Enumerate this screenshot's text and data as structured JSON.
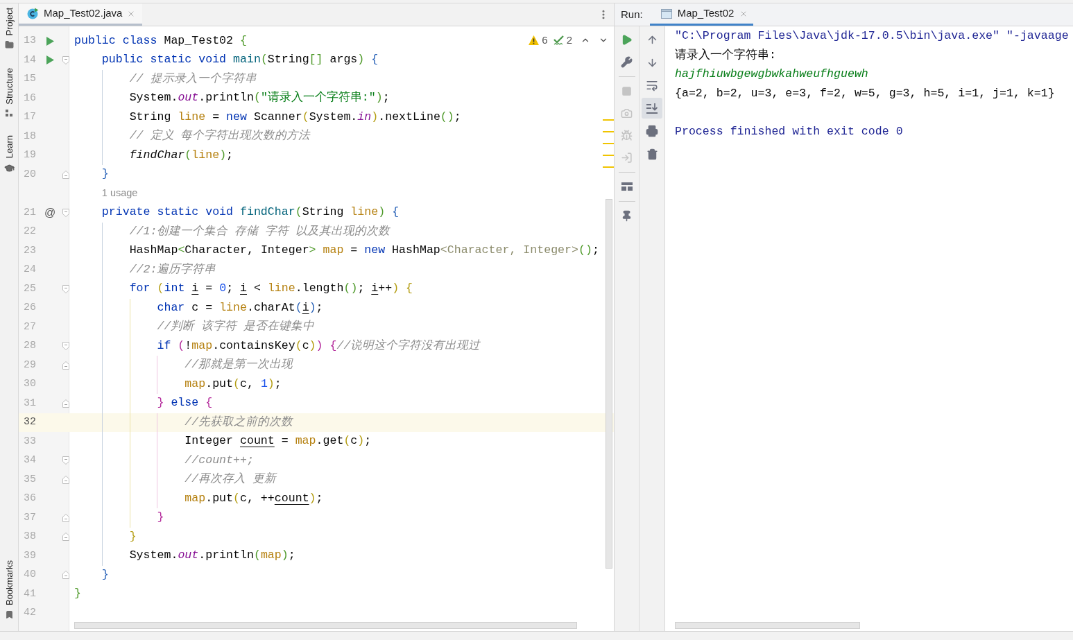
{
  "sidebar": {
    "items": [
      {
        "label": "Project"
      },
      {
        "label": "Structure"
      },
      {
        "label": "Learn"
      },
      {
        "label": "Bookmarks"
      }
    ]
  },
  "editor": {
    "tabs": [
      {
        "label": "Map_Test02.java",
        "selected": true
      }
    ],
    "inspections": {
      "warnings": "6",
      "typos": "2"
    },
    "lines": [
      {
        "number": "13",
        "current": false,
        "gutter_marker": {
          "kind": "run"
        },
        "tokens": [
          {
            "text": "public class ",
            "kind": "keyword"
          },
          {
            "text": "Map_Test02 ",
            "kind": "plain"
          },
          {
            "text": "{",
            "kind": "bracket1"
          }
        ]
      },
      {
        "number": "14",
        "current": false,
        "gutter_marker": {
          "kind": "run"
        },
        "fold_marker": {
          "kind": "start"
        },
        "tokens": [
          {
            "text": "    public static void ",
            "kind": "keyword"
          },
          {
            "text": "main",
            "kind": "declaration"
          },
          {
            "text": "(",
            "kind": "bracket1"
          },
          {
            "text": "String",
            "kind": "plain"
          },
          {
            "text": "[]",
            "kind": "bracket1"
          },
          {
            "text": " args",
            "kind": "plain"
          },
          {
            "text": ") ",
            "kind": "bracket1"
          },
          {
            "text": "{",
            "kind": "bracket2"
          }
        ]
      },
      {
        "number": "15",
        "current": false,
        "tokens": [
          {
            "text": "        // 提示录入一个字符串",
            "kind": "comment"
          }
        ]
      },
      {
        "number": "16",
        "current": false,
        "tokens": [
          {
            "text": "        System.",
            "kind": "plain"
          },
          {
            "text": "out",
            "kind": "field"
          },
          {
            "text": ".println",
            "kind": "plain"
          },
          {
            "text": "(",
            "kind": "bracket1"
          },
          {
            "text": "\"请录入一个字符串:\"",
            "kind": "string"
          },
          {
            "text": ")",
            "kind": "bracket1"
          },
          {
            "text": ";",
            "kind": "plain"
          }
        ]
      },
      {
        "number": "17",
        "current": false,
        "tokens": [
          {
            "text": "        String ",
            "kind": "plain"
          },
          {
            "text": "line",
            "kind": "param"
          },
          {
            "text": " = ",
            "kind": "plain"
          },
          {
            "text": "new ",
            "kind": "keyword"
          },
          {
            "text": "Scanner",
            "kind": "plain"
          },
          {
            "text": "(",
            "kind": "bracket3"
          },
          {
            "text": "System.",
            "kind": "plain"
          },
          {
            "text": "in",
            "kind": "field"
          },
          {
            "text": ")",
            "kind": "bracket3"
          },
          {
            "text": ".nextLine",
            "kind": "plain"
          },
          {
            "text": "()",
            "kind": "bracket1"
          },
          {
            "text": ";",
            "kind": "plain"
          }
        ]
      },
      {
        "number": "18",
        "current": false,
        "tokens": [
          {
            "text": "        // 定义 每个字符出现次数的方法",
            "kind": "comment"
          }
        ]
      },
      {
        "number": "19",
        "current": false,
        "tokens": [
          {
            "text": "        findChar",
            "kind": "static"
          },
          {
            "text": "(",
            "kind": "bracket1"
          },
          {
            "text": "line",
            "kind": "param"
          },
          {
            "text": ")",
            "kind": "bracket1"
          },
          {
            "text": ";",
            "kind": "plain"
          }
        ]
      },
      {
        "number": "20",
        "current": false,
        "fold_marker": {
          "kind": "end"
        },
        "tokens": [
          {
            "text": "    }",
            "kind": "bracket2"
          }
        ]
      },
      {
        "number": "21",
        "current": false,
        "gutter_marker": {
          "kind": "symbol",
          "text": "@"
        },
        "fold_marker": {
          "kind": "start"
        },
        "hint": "1 usage",
        "tokens": [
          {
            "text": "    private static void ",
            "kind": "keyword"
          },
          {
            "text": "findChar",
            "kind": "declaration"
          },
          {
            "text": "(",
            "kind": "bracket1"
          },
          {
            "text": "String ",
            "kind": "plain"
          },
          {
            "text": "line",
            "kind": "param"
          },
          {
            "text": ") ",
            "kind": "bracket1"
          },
          {
            "text": "{",
            "kind": "bracket2"
          }
        ]
      },
      {
        "number": "22",
        "current": false,
        "tokens": [
          {
            "text": "        //1:创建一个集合 存储 字符 以及其出现的次数",
            "kind": "comment"
          }
        ]
      },
      {
        "number": "23",
        "current": false,
        "tokens": [
          {
            "text": "        HashMap",
            "kind": "plain"
          },
          {
            "text": "<",
            "kind": "bracket1"
          },
          {
            "text": "Character, Integer",
            "kind": "plain"
          },
          {
            "text": "> ",
            "kind": "bracket1"
          },
          {
            "text": "map",
            "kind": "param"
          },
          {
            "text": " = ",
            "kind": "plain"
          },
          {
            "text": "new ",
            "kind": "keyword"
          },
          {
            "text": "HashMap",
            "kind": "plain"
          },
          {
            "text": "<Character, Integer>",
            "kind": "redundant"
          },
          {
            "text": "()",
            "kind": "bracket1"
          },
          {
            "text": ";",
            "kind": "plain"
          }
        ]
      },
      {
        "number": "24",
        "current": false,
        "tokens": [
          {
            "text": "        //2:遍历字符串",
            "kind": "comment"
          }
        ]
      },
      {
        "number": "25",
        "current": false,
        "fold_marker": {
          "kind": "start"
        },
        "tokens": [
          {
            "text": "        for ",
            "kind": "keyword"
          },
          {
            "text": "(",
            "kind": "bracket3"
          },
          {
            "text": "int ",
            "kind": "keyword"
          },
          {
            "text": "i",
            "kind": "reassigned"
          },
          {
            "text": " = ",
            "kind": "plain"
          },
          {
            "text": "0",
            "kind": "number"
          },
          {
            "text": "; ",
            "kind": "plain"
          },
          {
            "text": "i",
            "kind": "reassigned"
          },
          {
            "text": " < ",
            "kind": "plain"
          },
          {
            "text": "line",
            "kind": "param"
          },
          {
            "text": ".length",
            "kind": "plain"
          },
          {
            "text": "()",
            "kind": "bracket1"
          },
          {
            "text": "; ",
            "kind": "plain"
          },
          {
            "text": "i",
            "kind": "reassigned"
          },
          {
            "text": "++",
            "kind": "plain"
          },
          {
            "text": ") ",
            "kind": "bracket3"
          },
          {
            "text": "{",
            "kind": "bracket3"
          }
        ]
      },
      {
        "number": "26",
        "current": false,
        "tokens": [
          {
            "text": "            char ",
            "kind": "keyword"
          },
          {
            "text": "c = ",
            "kind": "plain"
          },
          {
            "text": "line",
            "kind": "param"
          },
          {
            "text": ".charAt",
            "kind": "plain"
          },
          {
            "text": "(",
            "kind": "bracket2"
          },
          {
            "text": "i",
            "kind": "reassigned"
          },
          {
            "text": ")",
            "kind": "bracket2"
          },
          {
            "text": ";",
            "kind": "plain"
          }
        ]
      },
      {
        "number": "27",
        "current": false,
        "tokens": [
          {
            "text": "            //判断 该字符 是否在键集中",
            "kind": "comment"
          }
        ]
      },
      {
        "number": "28",
        "current": false,
        "fold_marker": {
          "kind": "start"
        },
        "tokens": [
          {
            "text": "            if ",
            "kind": "keyword"
          },
          {
            "text": "(",
            "kind": "bracket4"
          },
          {
            "text": "!",
            "kind": "plain"
          },
          {
            "text": "map",
            "kind": "param"
          },
          {
            "text": ".containsKey",
            "kind": "plain"
          },
          {
            "text": "(",
            "kind": "bracket3"
          },
          {
            "text": "c",
            "kind": "plain"
          },
          {
            "text": ")",
            "kind": "bracket3"
          },
          {
            "text": ") ",
            "kind": "bracket4"
          },
          {
            "text": "{",
            "kind": "bracket4"
          },
          {
            "text": "//说明这个字符没有出现过",
            "kind": "comment"
          }
        ]
      },
      {
        "number": "29",
        "current": false,
        "fold_marker": {
          "kind": "end"
        },
        "tokens": [
          {
            "text": "                //那就是第一次出现",
            "kind": "comment"
          }
        ]
      },
      {
        "number": "30",
        "current": false,
        "tokens": [
          {
            "text": "                map",
            "kind": "param"
          },
          {
            "text": ".put",
            "kind": "plain"
          },
          {
            "text": "(",
            "kind": "bracket3"
          },
          {
            "text": "c, ",
            "kind": "plain"
          },
          {
            "text": "1",
            "kind": "number"
          },
          {
            "text": ")",
            "kind": "bracket3"
          },
          {
            "text": ";",
            "kind": "plain"
          }
        ]
      },
      {
        "number": "31",
        "current": false,
        "fold_marker": {
          "kind": "end"
        },
        "tokens": [
          {
            "text": "            } ",
            "kind": "bracket4"
          },
          {
            "text": "else ",
            "kind": "keyword"
          },
          {
            "text": "{",
            "kind": "bracket4"
          }
        ]
      },
      {
        "number": "32",
        "current": true,
        "tokens": [
          {
            "text": "                //先获取之前的次数",
            "kind": "comment"
          }
        ]
      },
      {
        "number": "33",
        "current": false,
        "tokens": [
          {
            "text": "                Integer ",
            "kind": "plain"
          },
          {
            "text": "count",
            "kind": "reassigned"
          },
          {
            "text": " = ",
            "kind": "plain"
          },
          {
            "text": "map",
            "kind": "param"
          },
          {
            "text": ".get",
            "kind": "plain"
          },
          {
            "text": "(",
            "kind": "bracket3"
          },
          {
            "text": "c",
            "kind": "plain"
          },
          {
            "text": ")",
            "kind": "bracket3"
          },
          {
            "text": ";",
            "kind": "plain"
          }
        ]
      },
      {
        "number": "34",
        "current": false,
        "fold_marker": {
          "kind": "start"
        },
        "tokens": [
          {
            "text": "                //count++;",
            "kind": "comment"
          }
        ]
      },
      {
        "number": "35",
        "current": false,
        "fold_marker": {
          "kind": "end"
        },
        "tokens": [
          {
            "text": "                //再次存入 更新",
            "kind": "comment"
          }
        ]
      },
      {
        "number": "36",
        "current": false,
        "tokens": [
          {
            "text": "                map",
            "kind": "param"
          },
          {
            "text": ".put",
            "kind": "plain"
          },
          {
            "text": "(",
            "kind": "bracket3"
          },
          {
            "text": "c, ++",
            "kind": "plain"
          },
          {
            "text": "count",
            "kind": "reassigned"
          },
          {
            "text": ")",
            "kind": "bracket3"
          },
          {
            "text": ";",
            "kind": "plain"
          }
        ]
      },
      {
        "number": "37",
        "current": false,
        "fold_marker": {
          "kind": "end"
        },
        "tokens": [
          {
            "text": "            }",
            "kind": "bracket4"
          }
        ]
      },
      {
        "number": "38",
        "current": false,
        "fold_marker": {
          "kind": "end"
        },
        "tokens": [
          {
            "text": "        }",
            "kind": "bracket3"
          }
        ]
      },
      {
        "number": "39",
        "current": false,
        "tokens": [
          {
            "text": "        System.",
            "kind": "plain"
          },
          {
            "text": "out",
            "kind": "field"
          },
          {
            "text": ".println",
            "kind": "plain"
          },
          {
            "text": "(",
            "kind": "bracket1"
          },
          {
            "text": "map",
            "kind": "param"
          },
          {
            "text": ")",
            "kind": "bracket1"
          },
          {
            "text": ";",
            "kind": "plain"
          }
        ]
      },
      {
        "number": "40",
        "current": false,
        "fold_marker": {
          "kind": "end"
        },
        "tokens": [
          {
            "text": "    }",
            "kind": "bracket2"
          }
        ]
      },
      {
        "number": "41",
        "current": false,
        "tokens": [
          {
            "text": "}",
            "kind": "bracket1"
          }
        ]
      },
      {
        "number": "42",
        "current": false
      }
    ]
  },
  "run": {
    "title": "Run:",
    "tabs": [
      {
        "label": "Map_Test02",
        "selected": true
      }
    ],
    "toolbar_left": [
      {
        "buttons": [
          {
            "kind": "rerun",
            "disabled": false
          },
          {
            "kind": "settings",
            "disabled": false
          }
        ]
      },
      {
        "buttons": [
          {
            "kind": "stop",
            "disabled": true
          },
          {
            "kind": "dump",
            "disabled": true
          },
          {
            "kind": "debug",
            "disabled": true
          },
          {
            "kind": "exit",
            "disabled": true
          }
        ]
      },
      {
        "buttons": [
          {
            "kind": "layout",
            "disabled": false
          }
        ]
      },
      {
        "buttons": [
          {
            "kind": "pin",
            "disabled": false
          }
        ]
      }
    ],
    "toolbar_right": [
      {
        "kind": "up",
        "selected": false
      },
      {
        "kind": "down",
        "selected": false
      },
      {
        "kind": "wrap",
        "selected": false
      },
      {
        "kind": "scroll",
        "selected": true
      },
      {
        "kind": "print",
        "selected": false
      },
      {
        "kind": "clear",
        "selected": false
      }
    ],
    "console": [
      {
        "text": "\"C:\\Program Files\\Java\\jdk-17.0.5\\bin\\java.exe\" \"-javaage",
        "kind": "command"
      },
      {
        "text": "请录入一个字符串:",
        "kind": "output"
      },
      {
        "text": "hajfhiuwbgewgbwkahweufhguewh",
        "kind": "input"
      },
      {
        "text": "{a=2, b=2, u=3, e=3, f=2, w=5, g=3, h=5, i=1, j=1, k=1}",
        "kind": "output"
      },
      {
        "text": "Process finished with exit code 0",
        "kind": "exit"
      }
    ]
  }
}
